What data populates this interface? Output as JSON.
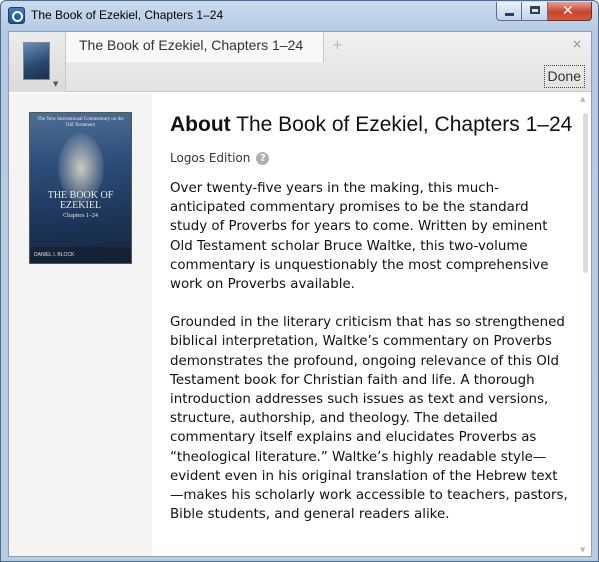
{
  "window": {
    "title": "The Book of Ezekiel, Chapters 1–24"
  },
  "tabs": {
    "active_label": "The Book of Ezekiel, Chapters 1–24",
    "add_label": "+",
    "close_label": "×"
  },
  "toolbar": {
    "done_label": "Done"
  },
  "cover": {
    "series": "The New International Commentary on the Old Testament",
    "title": "THE BOOK OF EZEKIEL",
    "subtitle": "Chapters 1–24",
    "author": "DANIEL I. BLOCK"
  },
  "about": {
    "heading_bold": "About",
    "heading_title": "The Book of Ezekiel, Chapters 1–24",
    "edition": "Logos Edition",
    "help_icon": "?",
    "paragraphs": [
      "Over twenty-five years in the making, this much-anticipated commentary promises to be the standard study of Proverbs for years to come. Written by eminent Old Testament scholar Bruce Waltke, this two-volume commentary is unquestionably the most comprehensive work on Proverbs available.",
      "Grounded in the literary criticism that has so strengthened biblical interpretation, Waltke’s commentary on Proverbs demonstrates the profound, ongoing relevance of this Old Testament book for Christian faith and life. A thorough introduction addresses such issues as text and versions, structure, authorship, and theology. The detailed commentary itself explains and elucidates Proverbs as “theological literature.” Waltke’s highly readable style—evident even in his original translation of the Hebrew text—makes his scholarly work accessible to teachers, pastors, Bible students, and general readers alike."
    ]
  },
  "icons": {
    "app": "logos-app-icon",
    "minimize": "minimize-icon",
    "maximize": "maximize-icon",
    "close": "close-icon",
    "help": "help-icon"
  }
}
